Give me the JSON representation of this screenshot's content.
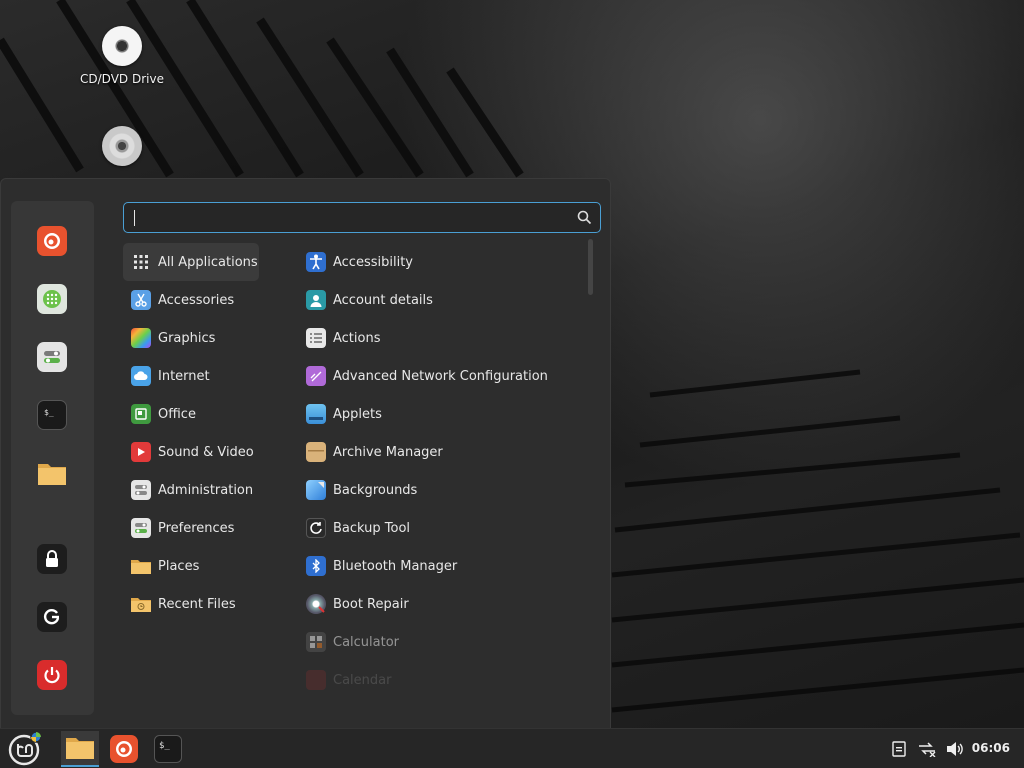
{
  "desktop": {
    "icons": [
      {
        "label": "CD/DVD Drive",
        "icon": "disc-icon"
      },
      {
        "label": "",
        "icon": "cd-icon"
      }
    ]
  },
  "menu": {
    "search": {
      "value": "",
      "placeholder": ""
    },
    "favorites": [
      {
        "icon": "firefox-icon"
      },
      {
        "icon": "software-manager-icon"
      },
      {
        "icon": "system-settings-icon"
      },
      {
        "icon": "terminal-icon"
      },
      {
        "icon": "files-icon"
      },
      {
        "icon": "lock-icon"
      },
      {
        "icon": "logout-icon"
      },
      {
        "icon": "power-icon"
      }
    ],
    "categories": [
      {
        "label": "All Applications",
        "icon": "grid-icon",
        "active": true
      },
      {
        "label": "Accessories",
        "icon": "scissors-icon"
      },
      {
        "label": "Graphics",
        "icon": "graphics-icon"
      },
      {
        "label": "Internet",
        "icon": "cloud-icon"
      },
      {
        "label": "Office",
        "icon": "office-icon"
      },
      {
        "label": "Sound & Video",
        "icon": "play-icon"
      },
      {
        "label": "Administration",
        "icon": "admin-icon"
      },
      {
        "label": "Preferences",
        "icon": "preferences-icon"
      },
      {
        "label": "Places",
        "icon": "folder-icon"
      },
      {
        "label": "Recent Files",
        "icon": "recent-folder-icon"
      }
    ],
    "apps": [
      {
        "label": "Accessibility",
        "icon": "accessibility-icon"
      },
      {
        "label": "Account details",
        "icon": "account-icon"
      },
      {
        "label": "Actions",
        "icon": "actions-icon"
      },
      {
        "label": "Advanced Network Configuration",
        "icon": "network-config-icon"
      },
      {
        "label": "Applets",
        "icon": "applets-icon"
      },
      {
        "label": "Archive Manager",
        "icon": "archive-icon"
      },
      {
        "label": "Backgrounds",
        "icon": "backgrounds-icon"
      },
      {
        "label": "Backup Tool",
        "icon": "backup-icon"
      },
      {
        "label": "Bluetooth Manager",
        "icon": "bluetooth-icon"
      },
      {
        "label": "Boot Repair",
        "icon": "boot-repair-icon"
      },
      {
        "label": "Calculator",
        "icon": "calculator-icon"
      },
      {
        "label": "Calendar",
        "icon": "calendar-icon"
      }
    ]
  },
  "taskbar": {
    "clock": "06:06"
  },
  "colors": {
    "accent": "#4a9fd4",
    "menu_bg": "#2d2d2d",
    "sidebar_bg": "#373737",
    "taskbar_bg": "#262626"
  }
}
